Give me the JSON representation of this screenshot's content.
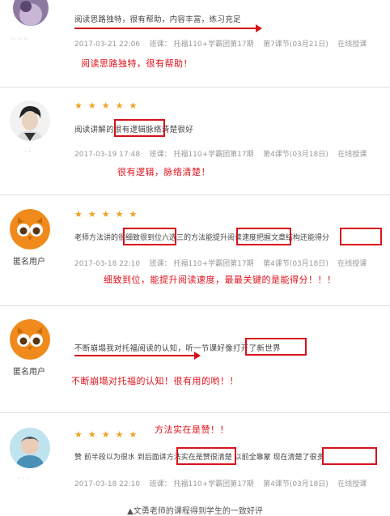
{
  "reviews": [
    {
      "review_text": "阅读思路独特，很有帮助，内容丰富，练习充足",
      "meta": {
        "datetime": "2017-03-21 22:06",
        "class_label": "班课：",
        "course": "托福110+学霸团第17期",
        "lesson": "第7课节(03月21日)",
        "mode": "在线授课"
      },
      "annotation": "阅读思路独特，很有帮助！"
    },
    {
      "stars": "★★★★★",
      "review_text": "阅读讲解的很有逻辑脉络清楚很好",
      "meta": {
        "datetime": "2017-03-19 17:48",
        "class_label": "班课：",
        "course": "托福110+学霸团第17期",
        "lesson": "第4课节(03月18日)",
        "mode": "在线授课"
      },
      "annotation": "很有逻辑，脉络清楚！"
    },
    {
      "stars": "★★★★★",
      "username": "匿名用户",
      "review_text": "老师方法讲的很细致很到位六选三的方法能提升阅读速度把握文章结构还能得分",
      "meta": {
        "datetime": "2017-03-18 22:10",
        "class_label": "班课：",
        "course": "托福110+学霸团第17期",
        "lesson": "第4课节(03月18日)",
        "mode": "在线授课"
      },
      "annotation": "细致到位，能提升阅读速度，最最关键的是能得分！！！"
    },
    {
      "username": "匿名用户",
      "review_text": "不断崩塌我对托福阅读的认知，听一节课好像打开了新世界",
      "annotation": "不断崩塌对托福的认知！很有用的哟！！"
    },
    {
      "stars": "★★★★★",
      "review_text": "赞 前半段以为很水 到后面讲方法实在是赞很清楚 以前全靠蒙 现在清楚了很多",
      "meta": {
        "datetime": "2017-03-18 22:10",
        "class_label": "班课：",
        "course": "托福110+学霸团第17期",
        "lesson": "第4课节(03月18日)",
        "mode": "在线授课"
      },
      "annotation": "方法实在是赞！！"
    }
  ],
  "caption": "▲文勇老师的课程得到学生的一致好评",
  "colors": {
    "annotation_red": "#e0101a",
    "star_orange": "#f0a020",
    "owl_orange": "#f08a1c",
    "meta_gray": "#9a9a9a"
  },
  "icons": {
    "anonymous_avatar": "owl-icon",
    "star": "star-icon"
  }
}
